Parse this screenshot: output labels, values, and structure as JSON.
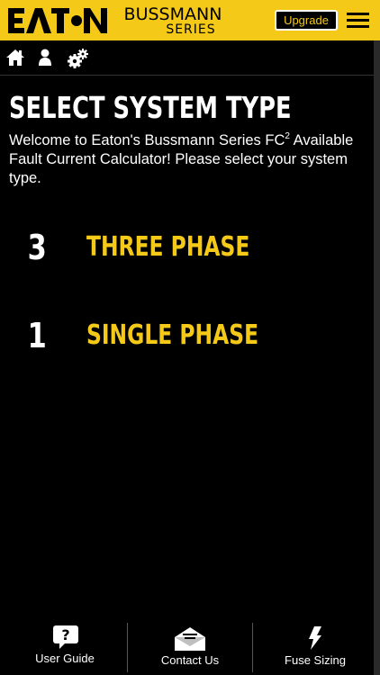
{
  "header": {
    "logo_text": "EATON",
    "brand_line1": "BUSSMANN",
    "brand_line2": "SERIES",
    "upgrade_label": "Upgrade",
    "menu_icon": "hamburger-menu-icon"
  },
  "toolbar": {
    "icons": [
      "home-icon",
      "user-icon",
      "gear-icon"
    ]
  },
  "page": {
    "title": "SELECT SYSTEM TYPE",
    "intro_before_sup": "Welcome to Eaton's Bussmann Series FC",
    "intro_sup": "2",
    "intro_after_sup": " Available Fault Current Calculator! Please select your system type."
  },
  "options": [
    {
      "number": "3",
      "label": "THREE PHASE"
    },
    {
      "number": "1",
      "label": "SINGLE PHASE"
    }
  ],
  "footer": {
    "items": [
      {
        "label": "User Guide",
        "icon": "question-icon"
      },
      {
        "label": "Contact Us",
        "icon": "envelope-icon"
      },
      {
        "label": "Fuse Sizing",
        "icon": "lightning-icon"
      }
    ]
  },
  "colors": {
    "accent": "#f5c918",
    "background": "#000000",
    "text": "#ffffff"
  }
}
